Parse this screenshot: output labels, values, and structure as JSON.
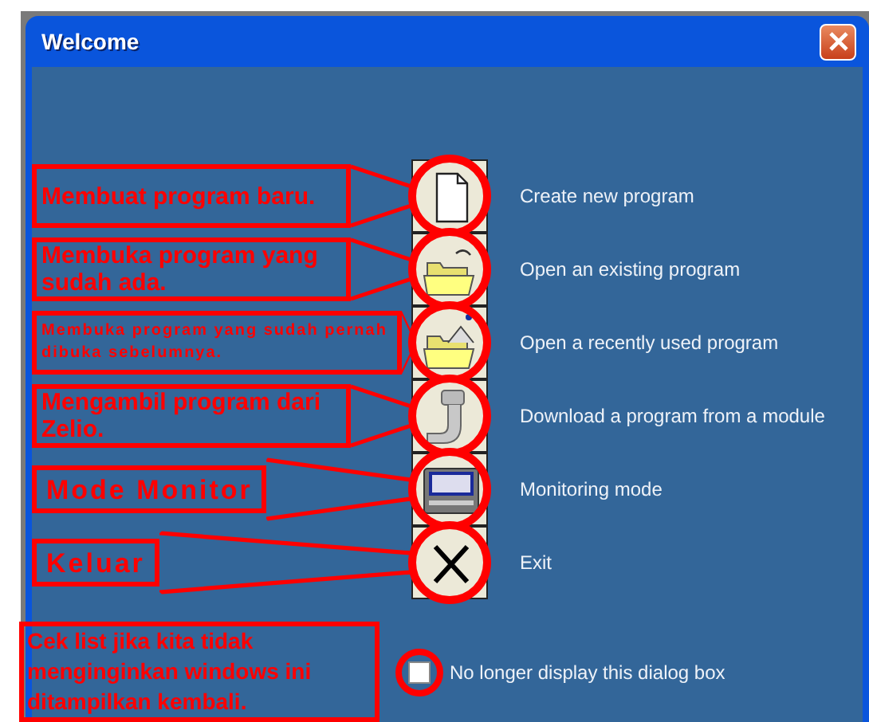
{
  "window": {
    "title": "Welcome"
  },
  "options": [
    {
      "kind": "document",
      "label": "Create new program",
      "note": {
        "text": "Membuat program baru.",
        "kind": "normal"
      }
    },
    {
      "kind": "folder",
      "label": "Open an existing program",
      "note": {
        "text": "Membuka program yang sudah ada.",
        "kind": "normal"
      }
    },
    {
      "kind": "recent",
      "label": "Open a recently used program",
      "note": {
        "text": "Membuka program yang sudah pernah dibuka sebelumnya.",
        "kind": "compact"
      }
    },
    {
      "kind": "plug",
      "label": "Download a program from a module",
      "note": {
        "text": "Mengambil program dari Zelio.",
        "kind": "normal"
      }
    },
    {
      "kind": "monitor",
      "label": "Monitoring mode",
      "note": {
        "text": "Mode Monitor",
        "kind": "wide"
      }
    },
    {
      "kind": "exit",
      "label": "Exit",
      "note": {
        "text": "Keluar",
        "kind": "wide"
      }
    }
  ],
  "checkbox": {
    "label": "No longer display this dialog box",
    "checked": false,
    "note": {
      "text": "Cek list jika kita tidak menginginkan windows ini ditampilkan kembali."
    }
  }
}
